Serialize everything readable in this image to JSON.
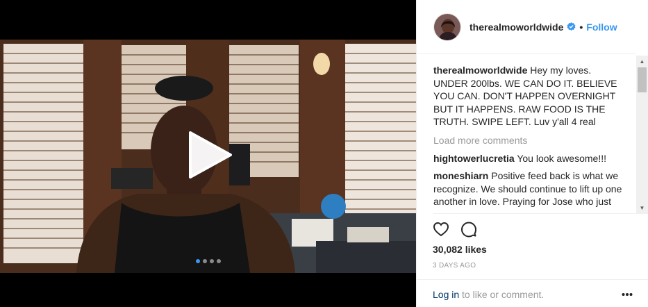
{
  "post": {
    "username": "therealmoworldwide",
    "separator": "•",
    "follow_label": "Follow",
    "caption_user": "therealmoworldwide",
    "caption_text": "Hey my loves. UNDER 200lbs. WE CAN DO IT. BELIEVE YOU CAN. DON'T HAPPEN OVERNIGHT BUT IT HAPPENS. RAW FOOD IS THE TRUTH. SWIPE LEFT. Luv y'all 4 real",
    "load_more": "Load more comments",
    "comments": [
      {
        "user": "hightowerlucretia",
        "text": "You look awesome!!!"
      },
      {
        "user": "moneshiarn",
        "text": "Positive feed back is what we recognize. We should continue to lift up one another in love. Praying for Jose who just can't say anything kind. Just don't say"
      }
    ],
    "likes": "30,082 likes",
    "time": "3 DAYS AGO",
    "login_link": "Log in",
    "login_suffix": " to like or comment.",
    "carousel": {
      "slides": 4,
      "active": 1
    },
    "icons": [
      "play-icon",
      "verified-badge-icon",
      "heart-icon",
      "comment-icon",
      "more-options-icon"
    ],
    "colors": {
      "link_blue": "#3897f0",
      "dark_link": "#003569",
      "muted": "#999999"
    }
  }
}
